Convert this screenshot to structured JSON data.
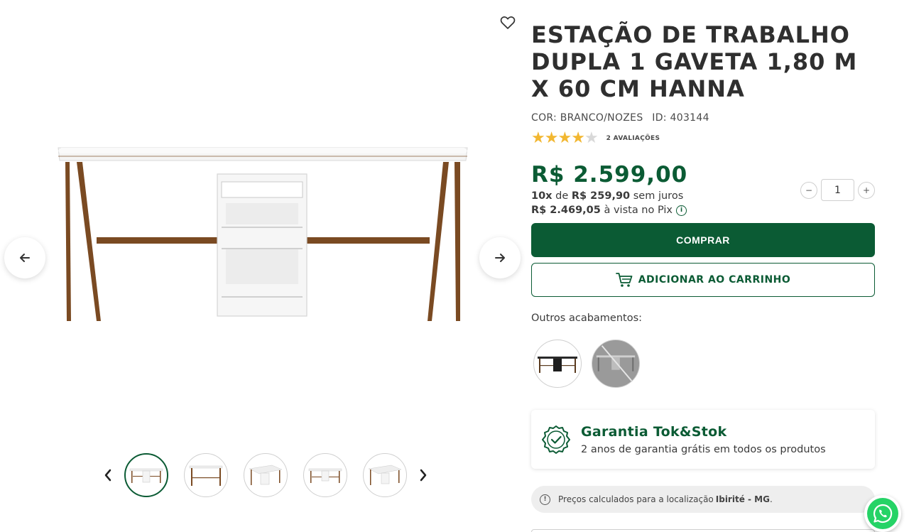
{
  "product": {
    "title": "ESTAÇÃO DE TRABALHO DUPLA 1 GAVETA 1,80 M X 60 CM HANNA",
    "color_label": "COR: BRANCO/NOZES",
    "id_label": "ID: 403144",
    "rating": 4,
    "rating_max": 5,
    "reviews_label": "2 AVALIAÇÕES",
    "star_color": "#f2b731"
  },
  "pricing": {
    "price": "R$ 2.599,00",
    "installments_count": "10x",
    "installments_de": "de",
    "installments_value": "R$ 259,90",
    "installments_suffix": "sem juros",
    "pix_value": "R$ 2.469,05",
    "pix_suffix": "à vista no Pix",
    "accent_color": "#0b5b34"
  },
  "quantity": {
    "value": "1",
    "decrease_icon": "minus-icon",
    "increase_icon": "plus-icon"
  },
  "actions": {
    "buy_label": "COMPRAR",
    "cart_label": "ADICIONAR AO CARRINHO"
  },
  "finishes": {
    "label": "Outros acabamentos:",
    "items": [
      {
        "name": "black-wood",
        "available": true
      },
      {
        "name": "gray",
        "available": false
      }
    ]
  },
  "warranty": {
    "title": "Garantia Tok&Stok",
    "subtitle": "2 anos de garantia grátis em todos os produtos"
  },
  "location": {
    "prefix": "Preços calculados para a localização",
    "place": "Ibirité - MG",
    "suffix": "."
  },
  "gallery": {
    "thumbnail_count": 5,
    "active_index": 0
  }
}
